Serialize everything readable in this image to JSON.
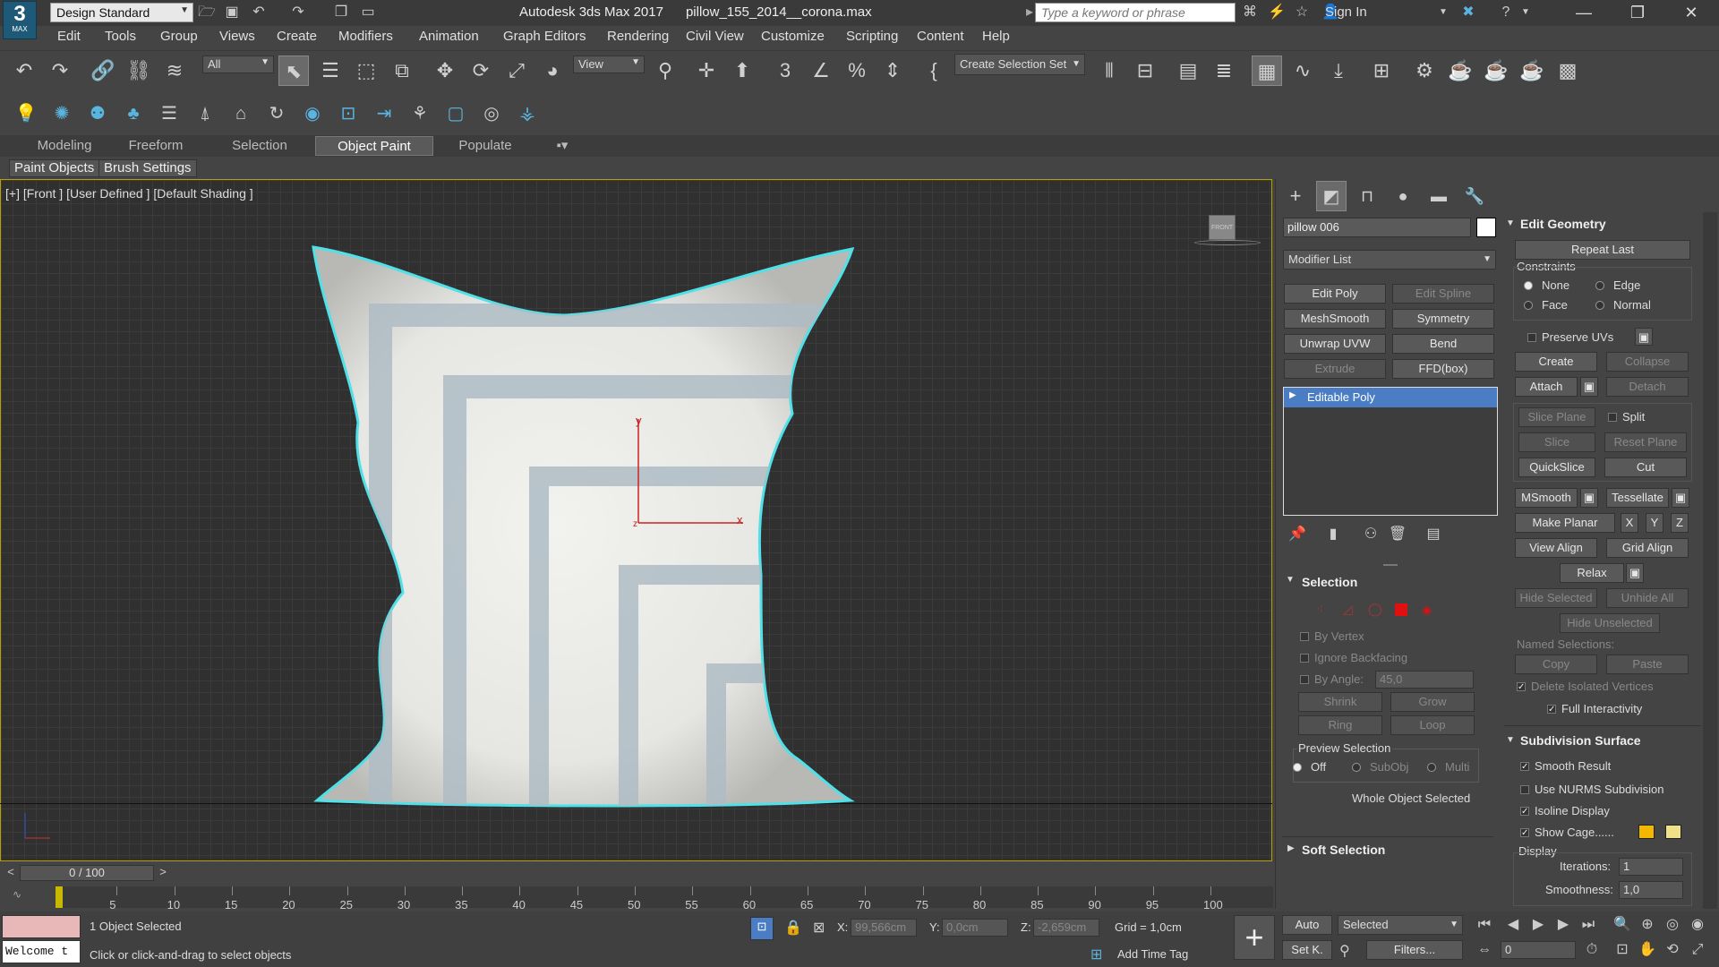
{
  "titlebar": {
    "logo_text": "3",
    "logo_sub": "MAX",
    "workspace": "Design Standard",
    "title": "Autodesk 3ds Max 2017      pillow_155_2014__corona.max",
    "search_placeholder": "Type a keyword or phrase",
    "sign_in": "Sign In"
  },
  "menu": [
    "Edit",
    "Tools",
    "Group",
    "Views",
    "Create",
    "Modifiers",
    "Animation",
    "Graph Editors",
    "Rendering",
    "Civil View",
    "Customize",
    "Scripting",
    "Content",
    "Help"
  ],
  "toolbar": {
    "filter": "All",
    "ref_coord": "View",
    "selection_set": "Create Selection Set"
  },
  "ribbon": {
    "tabs": [
      "Modeling",
      "Freeform",
      "Selection",
      "Object Paint",
      "Populate"
    ],
    "active_tab": "Object Paint",
    "sub_buttons": [
      "Paint Objects",
      "Brush Settings"
    ]
  },
  "viewport": {
    "label": "[+] [Front ] [User Defined ] [Default Shading ]",
    "gizmo_x": "x",
    "gizmo_y": "y",
    "gizmo_z": "z",
    "viewcube_label": "FRONT"
  },
  "command_panel": {
    "object_name": "pillow 006",
    "modifier_list": "Modifier List",
    "modifier_buttons": [
      {
        "label": "Edit Poly",
        "enabled": true
      },
      {
        "label": "Edit Spline",
        "enabled": false
      },
      {
        "label": "MeshSmooth",
        "enabled": true
      },
      {
        "label": "Symmetry",
        "enabled": true
      },
      {
        "label": "Unwrap UVW",
        "enabled": true
      },
      {
        "label": "Bend",
        "enabled": true
      },
      {
        "label": "Extrude",
        "enabled": false
      },
      {
        "label": "FFD(box)",
        "enabled": true
      }
    ],
    "stack_item": "Editable Poly",
    "selection": {
      "title": "Selection",
      "by_vertex": "By Vertex",
      "ignore_backfacing": "Ignore Backfacing",
      "by_angle": "By Angle:",
      "angle_value": "45,0",
      "shrink": "Shrink",
      "grow": "Grow",
      "ring": "Ring",
      "loop": "Loop",
      "preview_title": "Preview Selection",
      "preview_off": "Off",
      "preview_subobj": "SubObj",
      "preview_multi": "Multi",
      "whole_object": "Whole Object Selected"
    },
    "soft_selection": "Soft Selection"
  },
  "edit_geometry": {
    "title": "Edit Geometry",
    "repeat_last": "Repeat Last",
    "constraints": "Constraints",
    "none": "None",
    "edge": "Edge",
    "face": "Face",
    "normal": "Normal",
    "preserve_uvs": "Preserve UVs",
    "create": "Create",
    "collapse": "Collapse",
    "attach": "Attach",
    "detach": "Detach",
    "slice_plane": "Slice Plane",
    "split": "Split",
    "slice": "Slice",
    "reset_plane": "Reset Plane",
    "quickslice": "QuickSlice",
    "cut": "Cut",
    "msmooth": "MSmooth",
    "tessellate": "Tessellate",
    "make_planar": "Make Planar",
    "x": "X",
    "y": "Y",
    "z": "Z",
    "view_align": "View Align",
    "grid_align": "Grid Align",
    "relax": "Relax",
    "hide_selected": "Hide Selected",
    "unhide_all": "Unhide All",
    "hide_unselected": "Hide Unselected",
    "named_selections": "Named Selections:",
    "copy": "Copy",
    "paste": "Paste",
    "delete_isolated": "Delete Isolated Vertices",
    "full_interactivity": "Full Interactivity"
  },
  "subdivision": {
    "title": "Subdivision Surface",
    "smooth_result": "Smooth Result",
    "use_nurms": "Use NURMS Subdivision",
    "isoline": "Isoline Display",
    "show_cage": "Show Cage......",
    "display": "Display",
    "iterations_label": "Iterations:",
    "iterations": "1",
    "smoothness_label": "Smoothness:",
    "smoothness": "1,0",
    "cage_color1": "#f2b800",
    "cage_color2": "#f0e08a"
  },
  "timeline": {
    "frame": "0 / 100",
    "ticks": [
      "5",
      "10",
      "15",
      "20",
      "25",
      "30",
      "35",
      "40",
      "45",
      "50",
      "55",
      "60",
      "65",
      "70",
      "75",
      "80",
      "85",
      "90",
      "95",
      "100"
    ]
  },
  "status": {
    "welcome": "Welcome t",
    "selected": "1 Object Selected",
    "prompt": "Click or click-and-drag to select objects",
    "x_label": "X:",
    "x_value": "99,566cm",
    "y_label": "Y:",
    "y_value": "0,0cm",
    "z_label": "Z:",
    "z_value": "-2,659cm",
    "grid": "Grid = 1,0cm",
    "add_time_tag": "Add Time Tag",
    "auto": "Auto",
    "set_key": "Set K.",
    "key_filter": "Selected",
    "filters": "Filters...",
    "current_frame": "0"
  }
}
